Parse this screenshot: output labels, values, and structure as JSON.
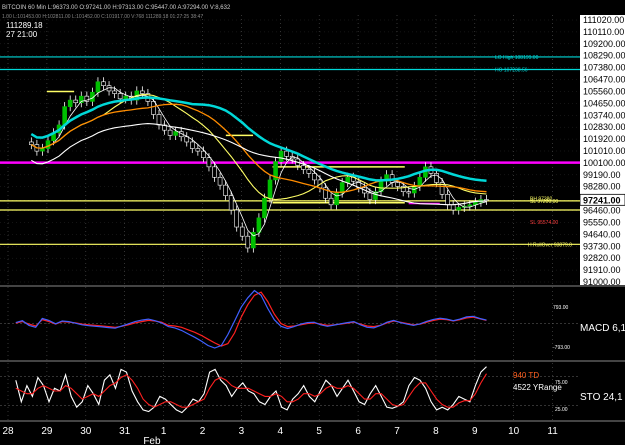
{
  "window": {
    "title_line": "BITCOIN 60 Min  L:96373.00  O:97241.00  H:97313.00  C:95447.00  A:97294.00  V:8,632",
    "top_left_price": "111289.18",
    "top_left_time": "27 21:00",
    "second_line": "1.00  L:101453.00  H:102811.00  L:101452.00  C:101917.00  V:768  111289.18  01:27:25  38:47"
  },
  "colors": {
    "background": "#000000",
    "price_axis_bg": "#ffffff",
    "candle_up": "#ffffff",
    "candle_down": "#ffffff",
    "wick": "#ffffff",
    "teal_line": "#00d8d8",
    "magenta_line": "#ff00ff",
    "orange_ma": "#ff8c00",
    "yellow_level": "#ffff66",
    "white_ma": "#ffffff",
    "macd_red": "#ff2020",
    "macd_blue": "#4060ff",
    "sto_red": "#ff2020",
    "sto_white": "#ffffff",
    "highlight_price_bg": "#ffffff"
  },
  "chart_data": [
    {
      "type": "line",
      "name": "price",
      "x_labels": [
        "28",
        "29",
        "30",
        "31",
        "1",
        "2",
        "3",
        "4",
        "5",
        "6",
        "7",
        "8",
        "9",
        "10",
        "11"
      ],
      "x_sublabel": "Feb",
      "y_tick_labels": [
        "111020.00",
        "110110.00",
        "109200.00",
        "108290.00",
        "107380.00",
        "106470.00",
        "105560.00",
        "104650.00",
        "103740.00",
        "102830.00",
        "101920.00",
        "101010.00",
        "100100.00",
        "99190.00",
        "98280.00",
        "97241.00",
        "96460.00",
        "95550.00",
        "94640.00",
        "93730.00",
        "92820.00",
        "91910.00",
        "91000.00"
      ],
      "ylim": [
        91000,
        111020
      ],
      "current_price": "97241.00",
      "annotations": [
        {
          "text": "LO High 108199.00",
          "color": "#00d8d8",
          "price": 108199
        },
        {
          "text": "HO 107238.56",
          "color": "#00d8d8",
          "price": 107238.56
        },
        {
          "text": "SL 97200.00",
          "color": "#ffff66",
          "price": 97200
        },
        {
          "text": "BH 97380",
          "color": "#ffff66",
          "price": 97380
        },
        {
          "text": "SL 95574.00",
          "color": "#ff4040",
          "price": 95574
        },
        {
          "text": "H RollOver 93879.0",
          "color": "#ffff66",
          "price": 93879
        }
      ],
      "horizontal_levels": [
        {
          "price": 108199,
          "color": "#00d8d8"
        },
        {
          "price": 107238,
          "color": "#00d8d8"
        },
        {
          "price": 100120,
          "color": "#ff00ff"
        },
        {
          "price": 93879,
          "color": "#ffff66"
        },
        {
          "price": 97200,
          "color": "#ffff66"
        },
        {
          "price": 96500,
          "color": "#ffff66"
        }
      ],
      "segments": [
        {
          "from_day": 1.0,
          "to_day": 1.7,
          "price": 105560,
          "color": "#ffff66"
        },
        {
          "from_day": 5.6,
          "to_day": 6.3,
          "price": 102200,
          "color": "#ffff66"
        },
        {
          "from_day": 6.8,
          "to_day": 10.2,
          "price": 99800,
          "color": "#ffff66"
        },
        {
          "from_day": 6.8,
          "to_day": 10.2,
          "price": 97060,
          "color": "#ffff66"
        },
        {
          "from_day": 10.3,
          "to_day": 11.1,
          "price": 97000,
          "color": "#ff00ff"
        }
      ],
      "closes": [
        101500,
        101000,
        101200,
        101800,
        102400,
        103000,
        104400,
        104900,
        104700,
        105200,
        104800,
        105500,
        106300,
        106000,
        105600,
        105400,
        105000,
        105200,
        104900,
        105600,
        105400,
        104800,
        103800,
        103000,
        102600,
        102200,
        102500,
        102100,
        101700,
        101200,
        101000,
        100500,
        99800,
        99000,
        98400,
        97600,
        96500,
        95200,
        94500,
        93600,
        94800,
        95900,
        97400,
        98800,
        100200,
        101000,
        100600,
        100400,
        99900,
        99600,
        99300,
        98800,
        98200,
        97400,
        96900,
        97800,
        98600,
        99000,
        98700,
        98200,
        97800,
        97300,
        97900,
        98700,
        99200,
        98600,
        98300,
        97900,
        97800,
        98300,
        99000,
        99800,
        99300,
        98600,
        97700,
        96900,
        96500,
        96700,
        96800,
        96900,
        97100,
        97300,
        97241
      ]
    },
    {
      "type": "line",
      "name": "MACD",
      "label": "MACD 6,13",
      "y_tick_labels": [
        "793.00",
        "-793.00"
      ],
      "series": [
        {
          "color": "#ff2020",
          "values": [
            10,
            60,
            -20,
            -80,
            120,
            60,
            -20,
            60,
            40,
            20,
            -20,
            -40,
            -60,
            -80,
            -100,
            -120,
            -90,
            -40,
            20,
            60,
            100,
            80,
            40,
            -60,
            -80,
            -120,
            -200,
            -280,
            -380,
            -500,
            -620,
            -720,
            -640,
            -300,
            200,
            600,
            900,
            1000,
            700,
            300,
            0,
            -100,
            -80,
            -40,
            0,
            20,
            -20,
            -60,
            -40,
            -20,
            10,
            40,
            -20,
            -80,
            -100,
            -60,
            20,
            80,
            40,
            0,
            -40,
            -20,
            40,
            100,
            140,
            120,
            80,
            120,
            180,
            200,
            150,
            100
          ]
        },
        {
          "color": "#4060ff",
          "values": [
            30,
            90,
            -60,
            -120,
            160,
            100,
            -10,
            80,
            60,
            10,
            -40,
            -70,
            -90,
            -110,
            -130,
            -150,
            -80,
            -10,
            60,
            110,
            140,
            90,
            20,
            -100,
            -140,
            -220,
            -330,
            -440,
            -560,
            -700,
            -780,
            -700,
            -350,
            80,
            520,
            820,
            1050,
            900,
            480,
            120,
            -90,
            -160,
            -100,
            -20,
            30,
            40,
            -40,
            -90,
            -50,
            -10,
            30,
            60,
            -40,
            -120,
            -140,
            -60,
            40,
            100,
            30,
            -20,
            -60,
            -10,
            70,
            130,
            170,
            140,
            90,
            140,
            210,
            230,
            160,
            110
          ]
        }
      ]
    },
    {
      "type": "line",
      "name": "STO",
      "label": "STO 24,1",
      "y_tick_labels": [
        "75.00",
        "25.00"
      ],
      "text_labels": [
        "940 TD",
        "4522 YRange"
      ],
      "series": [
        {
          "color": "#ffffff",
          "values": [
            70,
            30,
            60,
            40,
            75,
            60,
            30,
            55,
            50,
            80,
            40,
            20,
            30,
            60,
            45,
            25,
            70,
            80,
            55,
            90,
            85,
            50,
            30,
            15,
            12,
            20,
            40,
            35,
            25,
            15,
            10,
            20,
            35,
            30,
            45,
            85,
            90,
            70,
            60,
            40,
            55,
            65,
            50,
            45,
            30,
            25,
            40,
            50,
            20,
            15,
            35,
            45,
            60,
            40,
            30,
            50,
            70,
            60,
            40,
            55,
            70,
            50,
            30,
            25,
            45,
            60,
            40,
            20,
            18,
            22,
            30,
            60,
            75,
            70,
            55,
            30,
            15,
            20,
            15,
            25,
            40,
            35,
            30,
            60,
            85,
            95
          ]
        },
        {
          "color": "#ff2020",
          "values": [
            55,
            50,
            45,
            45,
            55,
            60,
            55,
            50,
            50,
            60,
            55,
            45,
            35,
            40,
            45,
            40,
            50,
            60,
            65,
            75,
            80,
            70,
            55,
            35,
            25,
            20,
            25,
            30,
            30,
            25,
            20,
            20,
            25,
            30,
            35,
            55,
            70,
            75,
            70,
            60,
            55,
            55,
            55,
            50,
            45,
            40,
            40,
            45,
            40,
            30,
            30,
            35,
            45,
            45,
            40,
            45,
            55,
            60,
            55,
            55,
            60,
            55,
            45,
            35,
            35,
            45,
            45,
            35,
            25,
            22,
            25,
            40,
            55,
            65,
            65,
            50,
            35,
            25,
            20,
            20,
            28,
            32,
            32,
            45,
            65,
            82
          ]
        }
      ]
    }
  ],
  "panels": {
    "macd_label": "MACD 6,13",
    "sto_label": "STO 24,1",
    "sto_text_1": "940 TD",
    "sto_text_2": "4522 YRange",
    "sto_tick_75": "75.00",
    "sto_tick_25": "25.00",
    "macd_tick_top": "793.00",
    "macd_tick_bottom": "-793.00"
  }
}
